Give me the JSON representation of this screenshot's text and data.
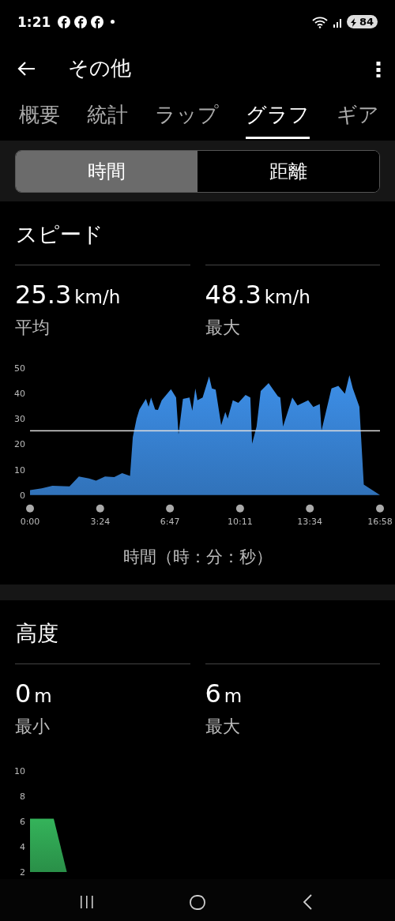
{
  "status_bar": {
    "time": "1:21",
    "battery": "84"
  },
  "app_bar": {
    "title": "その他"
  },
  "tabs": [
    {
      "label": "概要",
      "selected": false
    },
    {
      "label": "統計",
      "selected": false
    },
    {
      "label": "ラップ",
      "selected": false
    },
    {
      "label": "グラフ",
      "selected": true
    },
    {
      "label": "ギア",
      "selected": false
    }
  ],
  "segments": [
    {
      "label": "時間",
      "selected": true
    },
    {
      "label": "距離",
      "selected": false
    }
  ],
  "sections": [
    {
      "title": "スピード",
      "stats": [
        {
          "value": "25.3",
          "unit": "km/h",
          "label": "平均"
        },
        {
          "value": "48.3",
          "unit": "km/h",
          "label": "最大"
        }
      ],
      "chart_data": {
        "type": "area",
        "xlabel": "時間（時：分：秒）",
        "x": [
          0,
          34,
          65,
          115,
          142,
          172,
          192,
          218,
          245,
          268,
          291,
          299,
          310,
          318,
          337,
          345,
          352,
          364,
          372,
          383,
          410,
          425,
          432,
          445,
          464,
          472,
          481,
          487,
          502,
          521,
          529,
          540,
          556,
          568,
          575,
          590,
          606,
          627,
          641,
          646,
          659,
          671,
          694,
          721,
          728,
          736,
          763,
          778,
          809,
          824,
          843,
          848,
          877,
          897,
          916,
          929,
          939,
          958,
          971,
          1018
        ],
        "series": [
          {
            "color": "#3d8fe8",
            "values": [
              1.9,
              2.6,
              3.6,
              3.4,
              7.3,
              6.5,
              5.7,
              7.3,
              7.1,
              8.6,
              7.5,
              22.8,
              30.1,
              33.7,
              37.9,
              34.8,
              38.4,
              33.7,
              33.5,
              37.3,
              41.7,
              38.4,
              23.9,
              37.9,
              38.4,
              33.2,
              42,
              37.3,
              38.4,
              46.7,
              42,
              41.5,
              27.5,
              32.7,
              30.1,
              37.3,
              36.3,
              39.4,
              38.4,
              20.2,
              27,
              41,
              44.1,
              38.9,
              38.4,
              27,
              38.4,
              35.3,
              37.3,
              34.7,
              35.8,
              25.4,
              42,
              43,
              39.9,
              47.2,
              42,
              34.8,
              4.1,
              0
            ]
          }
        ],
        "xlim": [
          0,
          1018
        ],
        "ylim": [
          0,
          50
        ],
        "xticks": [
          {
            "value": 0,
            "label": "0:00"
          },
          {
            "value": 204,
            "label": "3:24"
          },
          {
            "value": 407,
            "label": "6:47"
          },
          {
            "value": 611,
            "label": "10:11"
          },
          {
            "value": 814,
            "label": "13:34"
          },
          {
            "value": 1018,
            "label": "16:58"
          }
        ],
        "yticks": [
          0,
          10,
          20,
          30,
          40,
          50
        ],
        "ref_lines": [
          {
            "axis": "y",
            "value": 25.3
          }
        ]
      }
    },
    {
      "title": "高度",
      "stats": [
        {
          "value": "0",
          "unit": "m",
          "label": "最小"
        },
        {
          "value": "6",
          "unit": "m",
          "label": "最大"
        }
      ],
      "chart_data": {
        "type": "area",
        "x": [
          0,
          69,
          107
        ],
        "series": [
          {
            "color": "#34b35a",
            "values": [
              6.2,
              6.2,
              2
            ]
          }
        ],
        "xlim": [
          0,
          1018
        ],
        "ylim": [
          2,
          10
        ],
        "yticks": [
          2,
          4,
          6,
          8,
          10
        ]
      }
    }
  ]
}
